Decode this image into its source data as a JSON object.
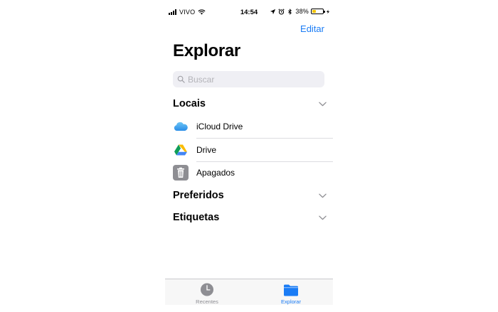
{
  "status_bar": {
    "carrier": "VIVO",
    "time": "14:54",
    "battery_percent": "38%",
    "battery_level": 0.38,
    "battery_color": "#f2c200"
  },
  "nav": {
    "edit_label": "Editar",
    "title": "Explorar"
  },
  "search": {
    "placeholder": "Buscar",
    "value": ""
  },
  "sections": {
    "locations": {
      "title": "Locais",
      "items": [
        {
          "label": "iCloud Drive",
          "icon": "icloud-icon"
        },
        {
          "label": "Drive",
          "icon": "google-drive-icon"
        },
        {
          "label": "Apagados",
          "icon": "trash-icon"
        }
      ]
    },
    "favorites": {
      "title": "Preferidos"
    },
    "tags": {
      "title": "Etiquetas"
    }
  },
  "tab_bar": {
    "tabs": [
      {
        "label": "Recentes",
        "icon": "clock-icon",
        "active": false
      },
      {
        "label": "Explorar",
        "icon": "folder-icon",
        "active": true
      }
    ]
  },
  "colors": {
    "accent": "#1a7cf5",
    "inactive": "#8e8e93",
    "search_background": "#efeff4"
  }
}
